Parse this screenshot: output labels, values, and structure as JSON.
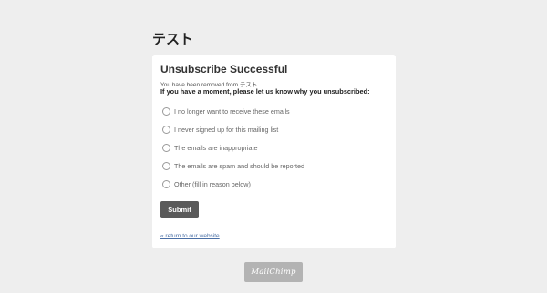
{
  "header": {
    "list_name": "テスト"
  },
  "card": {
    "title": "Unsubscribe Successful",
    "removed_prefix": "You have been removed from",
    "removed_list": "テスト",
    "question": "If you have a moment, please let us know why you unsubscribed:",
    "reasons": [
      "I no longer want to receive these emails",
      "I never signed up for this mailing list",
      "The emails are inappropriate",
      "The emails are spam and should be reported",
      "Other (fill in reason below)"
    ],
    "submit_label": "Submit",
    "return_link": "« return to our website"
  },
  "footer": {
    "badge_text": "MailChimp"
  }
}
